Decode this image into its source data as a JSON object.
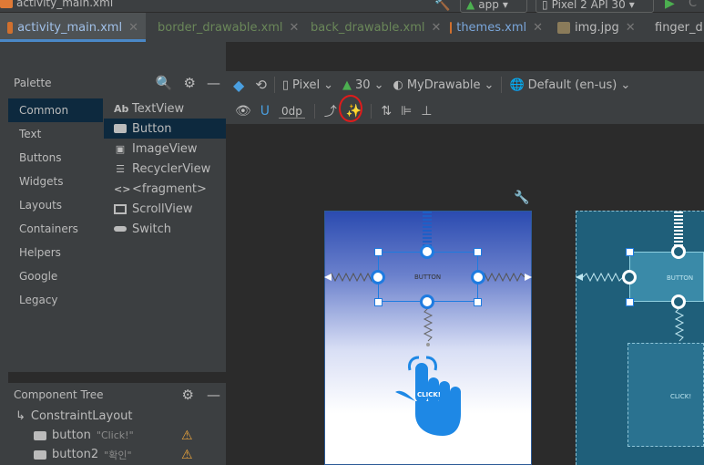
{
  "window": {
    "current_file": "activity_main.xml",
    "run_config": "app",
    "device": "Pixel 2 API 30"
  },
  "tabs": [
    {
      "label": "activity_main.xml",
      "active": true
    },
    {
      "label": "border_drawable.xml",
      "active": false
    },
    {
      "label": "back_drawable.xml",
      "active": false
    },
    {
      "label": "themes.xml",
      "active": false
    },
    {
      "label": "img.jpg",
      "active": false
    },
    {
      "label": "finger_d",
      "active": false
    }
  ],
  "palette": {
    "title": "Palette",
    "categories": [
      "Common",
      "Text",
      "Buttons",
      "Widgets",
      "Layouts",
      "Containers",
      "Helpers",
      "Google",
      "Legacy"
    ],
    "selected_category": "Common",
    "items": [
      {
        "label": "TextView",
        "icon": "text-view-icon"
      },
      {
        "label": "Button",
        "icon": "button-icon"
      },
      {
        "label": "ImageView",
        "icon": "image-view-icon"
      },
      {
        "label": "RecyclerView",
        "icon": "list-icon"
      },
      {
        "label": "<fragment>",
        "icon": "code-icon"
      },
      {
        "label": "ScrollView",
        "icon": "scroll-view-icon"
      },
      {
        "label": "Switch",
        "icon": "switch-icon"
      }
    ],
    "selected_item": "Button"
  },
  "component_tree": {
    "title": "Component Tree",
    "root": "ConstraintLayout",
    "children": [
      {
        "id": "button",
        "text": "\"Click!\""
      },
      {
        "id": "button2",
        "text": "\"확인\""
      }
    ]
  },
  "design_toolbar": {
    "device": "Pixel",
    "api": "30",
    "theme": "MyDrawable",
    "locale": "Default (en-us)",
    "margin": "0dp"
  },
  "canvas": {
    "button_text": "BUTTON",
    "click_text": "CLICK!"
  },
  "colors": {
    "accent": "#1e7be0",
    "annotation": "#e01b1b",
    "warning": "#e8a33d"
  }
}
